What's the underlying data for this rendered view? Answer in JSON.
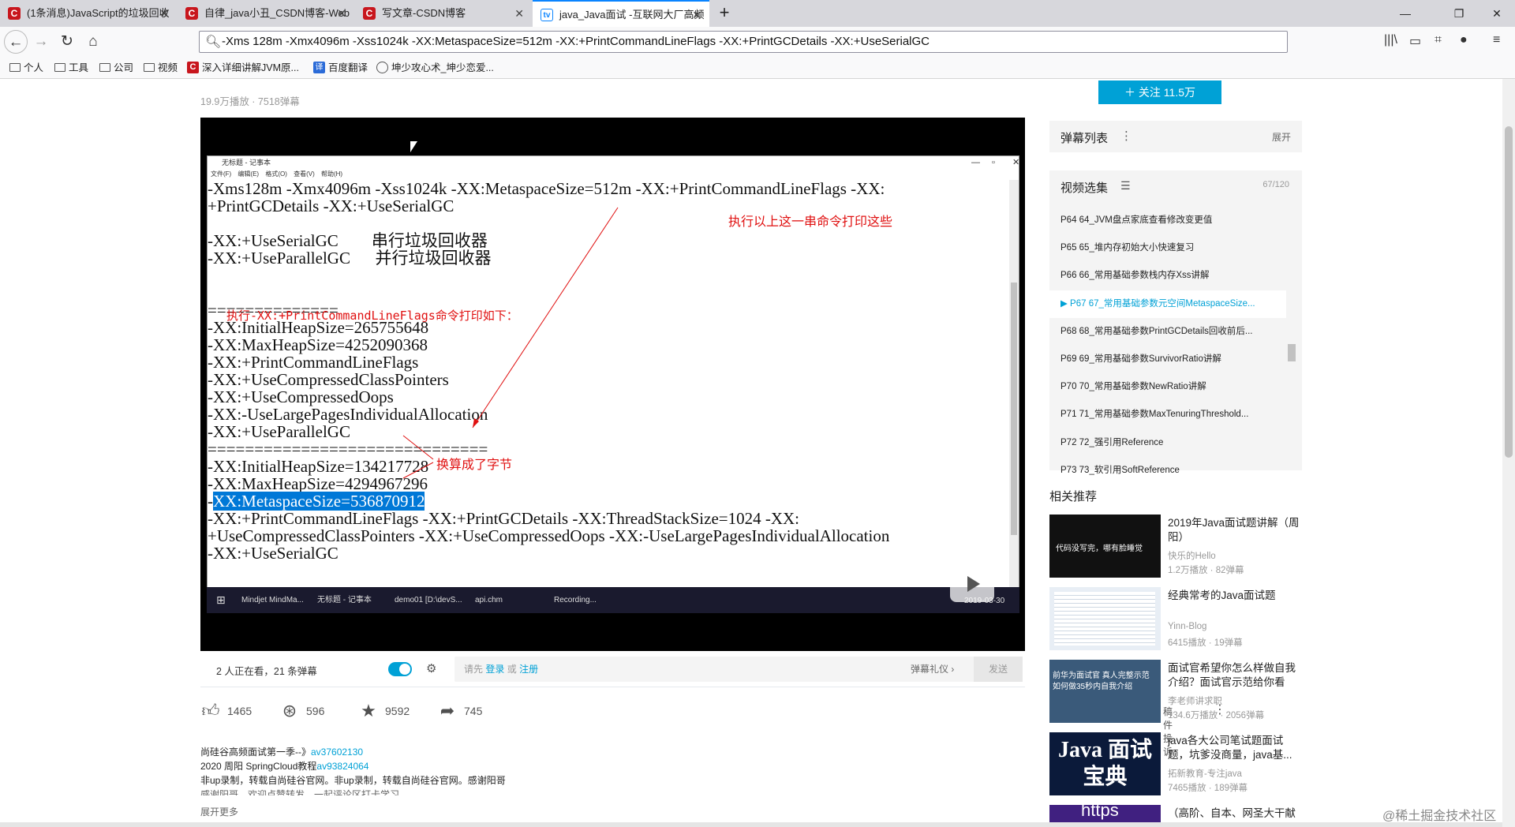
{
  "browser": {
    "tabs": [
      {
        "label": "(1条消息)JavaScript的垃圾回收",
        "icon": "C"
      },
      {
        "label": "自律_java小丑_CSDN博客-Web",
        "icon": "C"
      },
      {
        "label": "写文章-CSDN博客",
        "icon": "C"
      },
      {
        "label": "java_Java面试 -互联网大厂高频",
        "icon": "tv"
      }
    ],
    "new_tab": "+",
    "url": "-Xms 128m -Xmx4096m -Xss1024k -XX:MetaspaceSize=512m -XX:+PrintCommandLineFlags -XX:+PrintGCDetails -XX:+UseSerialGC",
    "bookmarks": [
      "个人",
      "工具",
      "公司",
      "视频",
      "深入详细讲解JVM原...",
      "百度翻译",
      "坤少攻心术_坤少恋爱..."
    ]
  },
  "page": {
    "stats": "19.9万播放 · 7518弹幕",
    "follow": "关注 11.5万",
    "notepad": {
      "title": "无标题 - 记事本",
      "menu": "文件(F) 编辑(E) 格式(O) 查看(V) 帮助(H)",
      "lines": [
        "-Xms128m -Xmx4096m -Xss1024k -XX:MetaspaceSize=512m -XX:+PrintCommandLineFlags -XX:",
        "+PrintGCDetails -XX:+UseSerialGC",
        "",
        "-XX:+UseSerialGC        串行垃圾回收器",
        "-XX:+UseParallelGC      并行垃圾回收器",
        "",
        "",
        "==============",
        "-XX:InitialHeapSize=265755648",
        "-XX:MaxHeapSize=4252090368",
        "-XX:+PrintCommandLineFlags",
        "-XX:+UseCompressedClassPointers",
        "-XX:+UseCompressedOops",
        "-XX:-UseLargePagesIndividualAllocation",
        "-XX:+UseParallelGC",
        "==============================",
        "-XX:InitialHeapSize=134217728",
        "-XX:MaxHeapSize=4294967296",
        "",
        "-XX:+PrintCommandLineFlags -XX:+PrintGCDetails -XX:ThreadStackSize=1024 -XX:",
        "+UseCompressedClassPointers -XX:+UseCompressedOops -XX:-UseLargePagesIndividualAllocation",
        "-XX:+UseSerialGC"
      ],
      "selected_line": "-XX:MetaspaceSize=536870912",
      "note1": "执行以上这一串命令打印这些",
      "note2": "执行-XX:+PrintCommandLineFlags命令打印如下：",
      "note3": "换算成了字节",
      "taskbar": [
        "Mindjet MindMa...",
        "无标题 - 记事本",
        "demo01 [D:\\devS...",
        "api.chm",
        "Recording..."
      ],
      "clock": "2019-03-30"
    },
    "sendbar": {
      "watching": "2 人正在看，21 条弹幕",
      "placeholder_pre": "请先",
      "login": "登录",
      "or": "或",
      "register": "注册",
      "etiquette": "弹幕礼仪 ›",
      "send": "发送"
    },
    "actions": {
      "like": "1465",
      "coin": "596",
      "fav": "9592",
      "share": "745",
      "report": "稿件投诉"
    },
    "desc": {
      "l1_text": "尚硅谷高频面试第一季--》",
      "l1_link": "av37602130",
      "l2_text": "2020 周阳 SpringCloud教程",
      "l2_link": "av93824064",
      "l3": "非up录制，转载自尚硅谷官网。非up录制，转载自尚硅谷官网。感谢阳哥",
      "l4": "感谢阳哥，欢迎点赞转发，一起评论区打卡学习",
      "expand": "展开更多"
    }
  },
  "sidebar": {
    "danmu_title": "弹幕列表",
    "danmu_expand": "展开",
    "playlist_title": "视频选集",
    "playlist_count": "67/120",
    "items": [
      "P64  64_JVM盘点家底查看修改变更值",
      "P65  65_堆内存初始大小快速复习",
      "P66  66_常用基础参数栈内存Xss讲解",
      "P67  67_常用基础参数元空间MetaspaceSize...",
      "P68  68_常用基础参数PrintGCDetails回收前后...",
      "P69  69_常用基础参数SurvivorRatio讲解",
      "P70  70_常用基础参数NewRatio讲解",
      "P71  71_常用基础参数MaxTenuringThreshold...",
      "P72  72_强引用Reference",
      "P73  73_软引用SoftReference"
    ],
    "current_index": 3,
    "related_title": "相关推荐",
    "related": [
      {
        "title": "2019年Java面试题讲解（周阳）",
        "up": "快乐的Hello",
        "stats": "1.2万播放 · 82弹幕",
        "thumb_text": "代码没写完，哪有脸睡觉"
      },
      {
        "title": "经典常考的Java面试题",
        "up": "Yinn-Blog",
        "stats": "6415播放 · 19弹幕",
        "thumb_text": ""
      },
      {
        "title": "面试官希望你怎么样做自我介绍？面试官示范给你看",
        "up": "李老师讲求职",
        "stats": "134.6万播放 · 2056弹幕",
        "thumb_text": "前华为面试官 真人完整示范 如何做35秒内自我介绍"
      },
      {
        "title": "java各大公司笔试题面试题，坑爹没商量，java基...",
        "up": "拓新教育-专注java",
        "stats": "7465播放 · 189弹幕",
        "thumb_text": "Java 面试宝典"
      },
      {
        "title": "（高阶、自本、网圣大干献",
        "up": "",
        "stats": "",
        "thumb_text": "https"
      }
    ]
  },
  "watermark": "@稀土掘金技术社区"
}
